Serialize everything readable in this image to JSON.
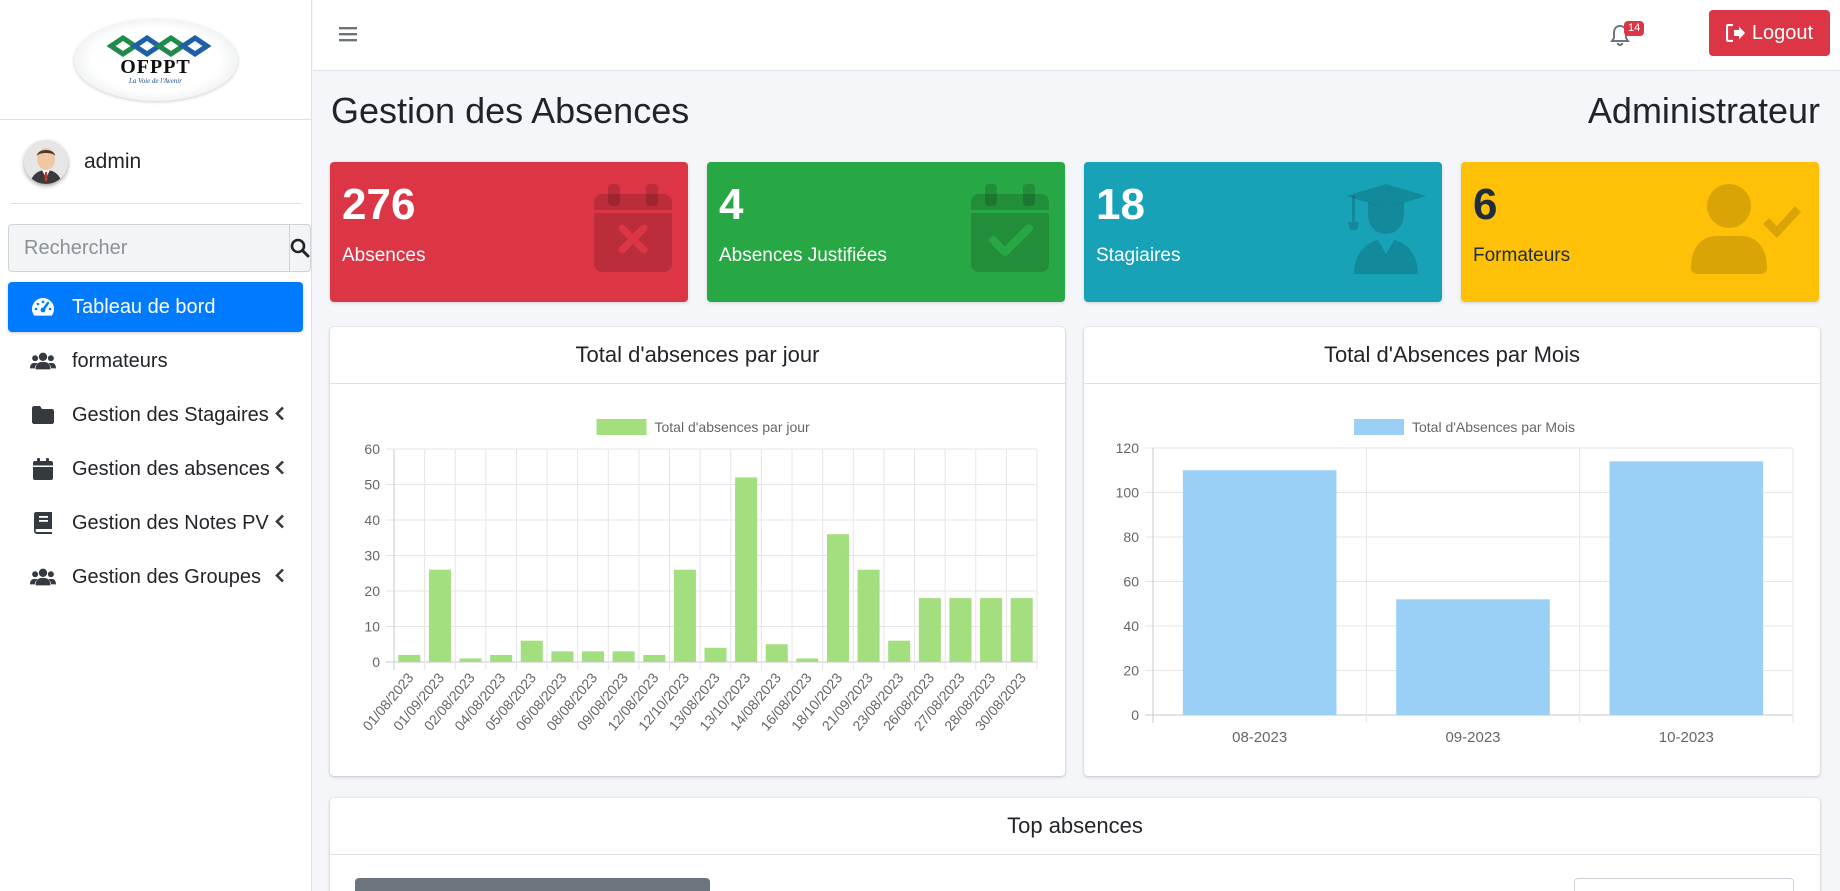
{
  "sidebar": {
    "logo_text": "OFPPT",
    "logo_tagline": "La Voie de l'Avenir",
    "user_name": "admin",
    "search_placeholder": "Rechercher",
    "items": [
      {
        "label": "Tableau de bord",
        "icon": "tachometer-icon",
        "active": true
      },
      {
        "label": "formateurs",
        "icon": "users-icon"
      },
      {
        "label": "Gestion des Stagaires",
        "icon": "folder-icon"
      },
      {
        "label": "Gestion des absences",
        "icon": "calendar-icon"
      },
      {
        "label": "Gestion des Notes PV",
        "icon": "book-icon"
      },
      {
        "label": "Gestion des Groupes",
        "icon": "users-icon"
      }
    ]
  },
  "topbar": {
    "notification_count": "14",
    "logout_label": "Logout"
  },
  "page": {
    "title": "Gestion des Absences",
    "role": "Administrateur"
  },
  "stats": [
    {
      "value": "276",
      "label": "Absences",
      "color": "#dc3545",
      "icon": "calendar-times-icon"
    },
    {
      "value": "4",
      "label": "Absences Justifiées",
      "color": "#28a745",
      "icon": "calendar-check-icon"
    },
    {
      "value": "18",
      "label": "Stagiaires",
      "color": "#17a2b8",
      "icon": "graduate-icon"
    },
    {
      "value": "6",
      "label": "Formateurs",
      "color": "#ffc107",
      "icon": "user-check-icon"
    }
  ],
  "cards": {
    "daily_title": "Total d'absences par jour",
    "monthly_title": "Total d'Absences par Mois",
    "top_title": "Top absences"
  },
  "chart_data": [
    {
      "type": "bar",
      "title": "Total d'absences par jour",
      "series": [
        {
          "name": "Total d'absences par jour",
          "color": "#a3de7f",
          "values": [
            2,
            26,
            1,
            2,
            6,
            3,
            3,
            3,
            2,
            26,
            4,
            52,
            5,
            1,
            36,
            26,
            6,
            18,
            18,
            18,
            18
          ]
        }
      ],
      "categories": [
        "01/08/2023",
        "01/09/2023",
        "02/08/2023",
        "04/08/2023",
        "05/08/2023",
        "06/08/2023",
        "08/08/2023",
        "09/08/2023",
        "12/08/2023",
        "12/10/2023",
        "13/08/2023",
        "13/10/2023",
        "14/08/2023",
        "16/08/2023",
        "18/10/2023",
        "21/09/2023",
        "23/08/2023",
        "26/08/2023",
        "27/08/2023",
        "28/08/2023",
        "30/08/2023"
      ],
      "ylim": [
        0,
        60
      ],
      "yticks": [
        0,
        10,
        20,
        30,
        40,
        50,
        60
      ],
      "legend": "top",
      "grid": true
    },
    {
      "type": "bar",
      "title": "Total d'Absences par Mois",
      "series": [
        {
          "name": "Total d'Absences par Mois",
          "color": "#9ad0f5",
          "values": [
            110,
            52,
            114
          ]
        }
      ],
      "categories": [
        "08-2023",
        "09-2023",
        "10-2023"
      ],
      "ylim": [
        0,
        120
      ],
      "yticks": [
        0,
        20,
        40,
        60,
        80,
        100,
        120
      ],
      "legend": "top",
      "grid": true
    }
  ]
}
